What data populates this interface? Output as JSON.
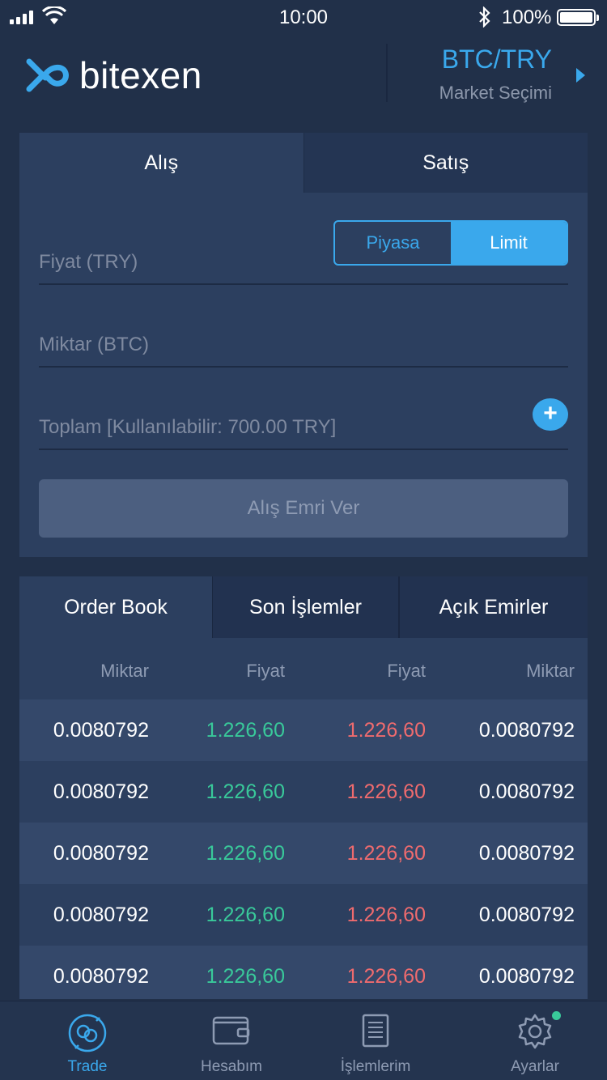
{
  "status_bar": {
    "time": "10:00",
    "battery": "100%"
  },
  "header": {
    "brand": "bitexen",
    "market_pair": "BTC/TRY",
    "market_label": "Market Seçimi",
    "colors": {
      "accent": "#3aa8ec",
      "background": "#213049"
    }
  },
  "order_form": {
    "tabs": [
      {
        "label": "Alış",
        "active": true
      },
      {
        "label": "Satış",
        "active": false
      }
    ],
    "type_toggle": {
      "options": [
        "Piyasa",
        "Limit"
      ],
      "selected": "Limit"
    },
    "price_placeholder": "Fiyat (TRY)",
    "amount_placeholder": "Miktar (BTC)",
    "total_placeholder": "Toplam [Kullanılabilir: 700.00 TRY]",
    "add_icon": "plus-icon",
    "submit_label": "Alış Emri Ver"
  },
  "order_book": {
    "tabs": [
      {
        "label": "Order Book",
        "active": true
      },
      {
        "label": "Son İşlemler",
        "active": false
      },
      {
        "label": "Açık Emirler",
        "active": false
      }
    ],
    "columns": [
      "Miktar",
      "Fiyat",
      "Fiyat",
      "Miktar"
    ],
    "rows": [
      {
        "bid_amount": "0.0080792",
        "bid_price": "1.226,60",
        "ask_price": "1.226,60",
        "ask_amount": "0.0080792"
      },
      {
        "bid_amount": "0.0080792",
        "bid_price": "1.226,60",
        "ask_price": "1.226,60",
        "ask_amount": "0.0080792"
      },
      {
        "bid_amount": "0.0080792",
        "bid_price": "1.226,60",
        "ask_price": "1.226,60",
        "ask_amount": "0.0080792"
      },
      {
        "bid_amount": "0.0080792",
        "bid_price": "1.226,60",
        "ask_price": "1.226,60",
        "ask_amount": "0.0080792"
      },
      {
        "bid_amount": "0.0080792",
        "bid_price": "1.226,60",
        "ask_price": "1.226,60",
        "ask_amount": "0.0080792"
      }
    ],
    "colors": {
      "bid": "#39c99a",
      "ask": "#ef6b6e"
    }
  },
  "tab_bar": {
    "items": [
      {
        "label": "Trade",
        "icon": "trade-icon",
        "active": true
      },
      {
        "label": "Hesabım",
        "icon": "wallet-icon",
        "active": false
      },
      {
        "label": "İşlemlerim",
        "icon": "document-icon",
        "active": false
      },
      {
        "label": "Ayarlar",
        "icon": "gear-icon",
        "active": false,
        "badge": true
      }
    ]
  }
}
